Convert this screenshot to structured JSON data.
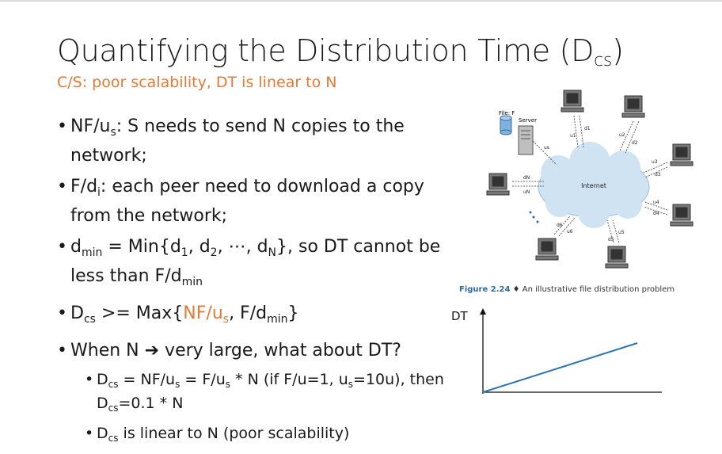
{
  "slide": {
    "title_main": "Quantifying the Distribution Time (D",
    "title_sub": "cs",
    "title_close": ")",
    "subtitle": "C/S: poor scalability, DT is linear to N"
  },
  "bullets": {
    "b1": {
      "a": "NF/u",
      "s": "s",
      "b": ": S needs to send N copies to the network;"
    },
    "b2": {
      "a": "F/d",
      "s": "i",
      "b": ": each peer need to download a copy from the network;"
    },
    "b3": {
      "a": "d",
      "s1": "min",
      "b": " = Min{d",
      "s2": "1",
      "c": ", d",
      "s3": "2",
      "d": ", ⋯, d",
      "s4": "N",
      "e": "}, so DT cannot be less than F/d",
      "s5": "min"
    },
    "b4": {
      "a": "D",
      "s1": "cs",
      "b": " >= Max{",
      "c": "NF/u",
      "s2": "s",
      "d": ",",
      "e": " F/d",
      "s3": "min",
      "f": "}"
    },
    "b5": {
      "text": "When N ➔ very large, what about DT?"
    }
  },
  "subbullets": {
    "s1": {
      "a": "D",
      "s1": "cs",
      "b": " = NF/u",
      "s2": "s",
      "c": " = F/u",
      "s3": "s",
      "d": " * N (if F/u=1, u",
      "s4": "s",
      "e": "=10u), then D",
      "s5": "cs",
      "f": "=0.1 * N"
    },
    "s2": {
      "a": "D",
      "s1": "cs",
      "b": " is linear to N (poor scalability)"
    }
  },
  "figure": {
    "file_label": "File: F",
    "server_label": "Server",
    "internet_label": "Internet",
    "caption_no": "Figure 2.24",
    "caption_sep": "♦",
    "caption_text": "An illustrative file distribution problem",
    "links": [
      "u1",
      "d1",
      "u2",
      "d2",
      "u3",
      "d3",
      "u4",
      "d4",
      "u5",
      "d5",
      "u6",
      "d6",
      "dN",
      "uN",
      "us"
    ]
  },
  "graph": {
    "y_label": "DT",
    "line_color": "#2e75b6"
  }
}
